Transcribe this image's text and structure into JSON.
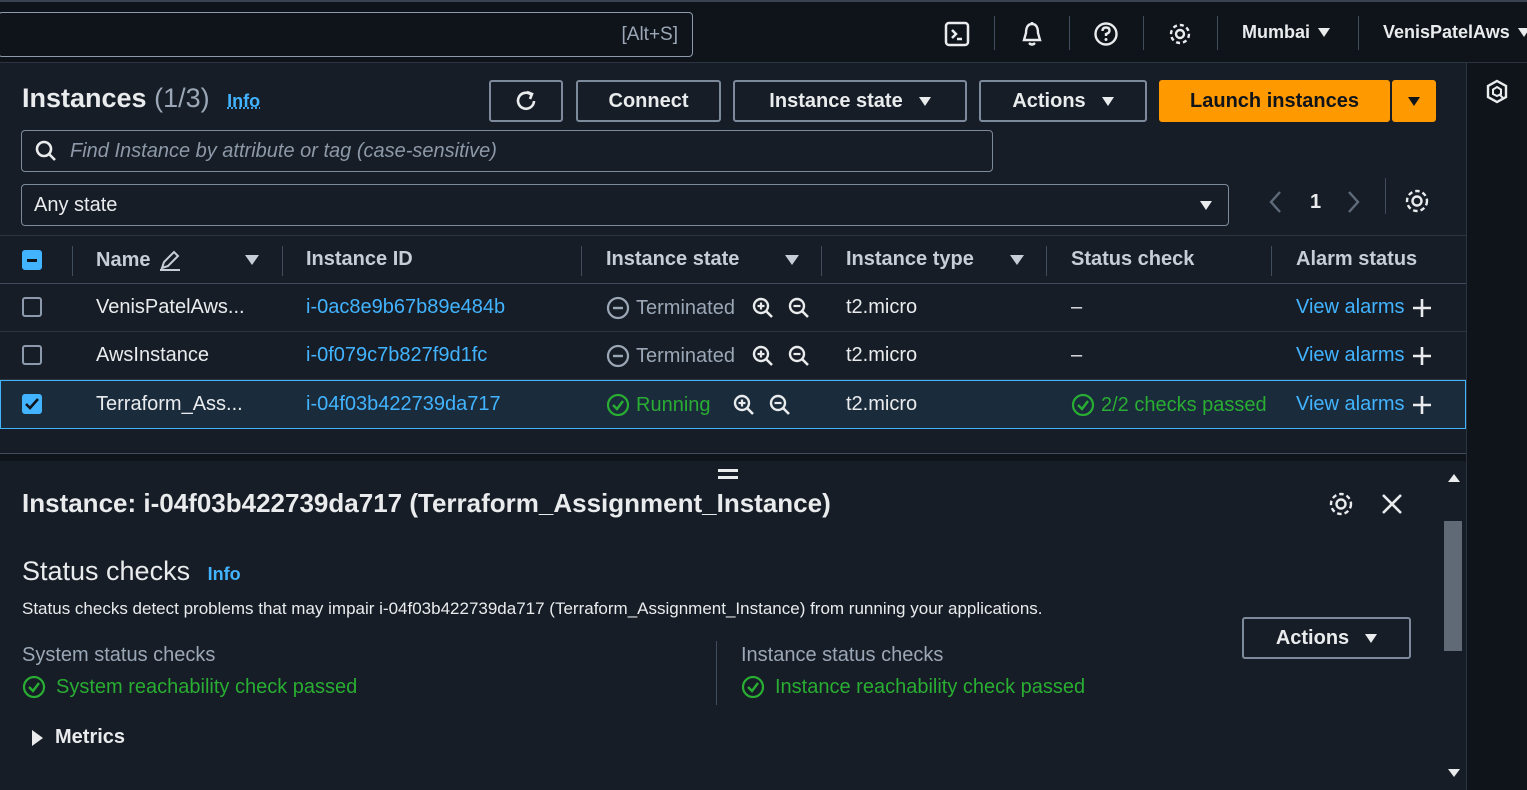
{
  "topbar": {
    "search_shortcut": "[Alt+S]",
    "region": "Mumbai",
    "account": "VenisPatelAws",
    "icons": [
      "cloudshell-icon",
      "bell-icon",
      "help-icon",
      "settings-icon"
    ]
  },
  "header": {
    "title": "Instances",
    "count": "(1/3)",
    "info": "Info",
    "connect": "Connect",
    "instance_state": "Instance state",
    "actions": "Actions",
    "launch": "Launch instances",
    "search_placeholder": "Find Instance by attribute or tag (case-sensitive)",
    "state_filter": "Any state",
    "page": "1"
  },
  "table": {
    "columns": [
      "Name",
      "Instance ID",
      "Instance state",
      "Instance type",
      "Status check",
      "Alarm status"
    ],
    "rows": [
      {
        "selected": false,
        "name": "VenisPatelAws...",
        "id": "i-0ac8e9b67b89e484b",
        "state": "Terminated",
        "type": "t2.micro",
        "status": "–",
        "alarm": "View alarms"
      },
      {
        "selected": false,
        "name": "AwsInstance",
        "id": "i-0f079c7b827f9d1fc",
        "state": "Terminated",
        "type": "t2.micro",
        "status": "–",
        "alarm": "View alarms"
      },
      {
        "selected": true,
        "name": "Terraform_Ass...",
        "id": "i-04f03b422739da717",
        "state": "Running",
        "type": "t2.micro",
        "status": "2/2 checks passed",
        "alarm": "View alarms"
      }
    ]
  },
  "detail": {
    "title": "Instance: i-04f03b422739da717 (Terraform_Assignment_Instance)",
    "status_checks_title": "Status checks",
    "info": "Info",
    "actions": "Actions",
    "description": "Status checks detect problems that may impair i-04f03b422739da717 (Terraform_Assignment_Instance) from running your applications.",
    "system_label": "System status checks",
    "system_result": "System reachability check passed",
    "instance_label": "Instance status checks",
    "instance_result": "Instance reachability check passed",
    "metrics": "Metrics"
  },
  "colors": {
    "accent": "#42b4ff",
    "orange": "#ff9900",
    "success": "#29ad32"
  }
}
